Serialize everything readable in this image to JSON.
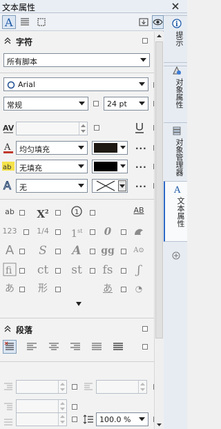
{
  "window": {
    "title": "文本属性"
  },
  "character": {
    "header": "字符",
    "script_dropdown": "所有脚本",
    "font_family": "Arial",
    "font_style": "常规",
    "font_size": "24 pt",
    "fill": {
      "label": "均匀填充",
      "color": "#1f1914"
    },
    "bg_fill": {
      "label": "无填充",
      "color": "#000000"
    },
    "outline": {
      "label": "无"
    },
    "glyphs": {
      "subscript_x": "X",
      "superscript_2": "2",
      "circled_1": "1",
      "fraction": "1/4",
      "ordinal": "1",
      "ordinal_suffix": "st",
      "slashed_zero": "0",
      "swash_s": "S",
      "stylistic_a": "A",
      "gg": "gg",
      "ct": "ct",
      "st": "st",
      "fs": "fs",
      "ab_lower": "ab",
      "ab_upper": "AB",
      "num_123": "123",
      "a_kana": "あ",
      "xing": "形",
      "a_kana2": "あ"
    }
  },
  "paragraph": {
    "header": "段落",
    "line_spacing": "100.0 %"
  },
  "tabs": [
    {
      "label": "提示"
    },
    {
      "label": "对象属性"
    },
    {
      "label": "对象管理器"
    },
    {
      "label": "文本属性"
    }
  ]
}
